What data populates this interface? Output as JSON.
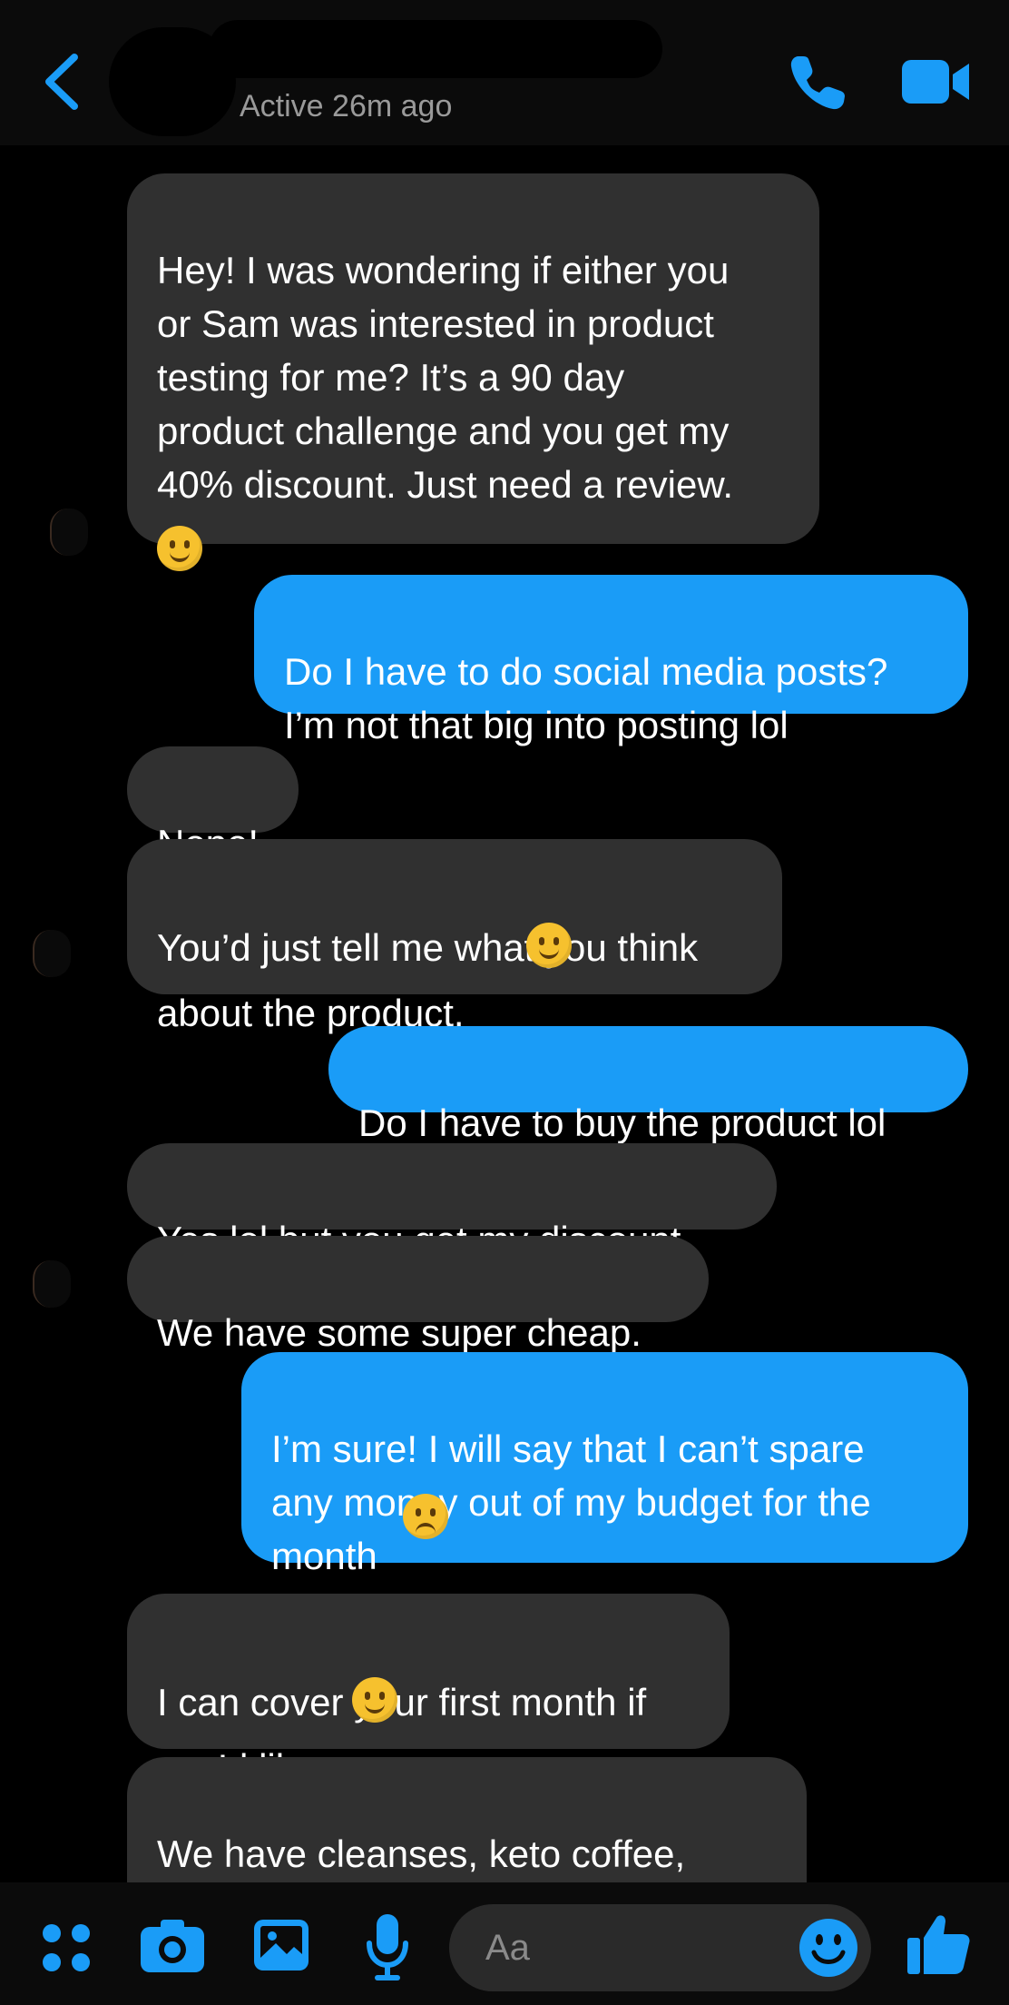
{
  "header": {
    "status": "Active 26m ago"
  },
  "messages": [
    {
      "side": "in",
      "text": "Hey! I was wondering if either you\nor Sam was interested in product\ntesting for me? It’s a 90 day\nproduct challenge and you get my\n40% discount. Just need a review.",
      "emoji": "slightly-smiling"
    },
    {
      "side": "out",
      "text": "Do I have to do social media posts?\nI’m not that big into posting lol"
    },
    {
      "side": "in",
      "text": "Nope!"
    },
    {
      "side": "in",
      "text": "You’d just tell me what you think\nabout the product.",
      "emoji": "slightly-smiling"
    },
    {
      "side": "out",
      "text": "Do I have to buy the product lol"
    },
    {
      "side": "in",
      "text": "Yes lol but you get my discount."
    },
    {
      "side": "in",
      "text": "We have some super cheap."
    },
    {
      "side": "out",
      "text": "I’m sure! I will say that I can’t spare\nany money out of my budget for the\nmonth",
      "emoji": "disappointed"
    },
    {
      "side": "in",
      "text": "I can cover your first month if\nyou’d like.",
      "emoji": "slightly-smiling"
    },
    {
      "side": "in",
      "text": "We have cleanses, keto coffee,\nhydrate, creams, etc. oh and"
    }
  ],
  "composer": {
    "placeholder": "Aa",
    "icons": [
      "menu-icon",
      "camera-icon",
      "gallery-icon",
      "microphone-icon",
      "emoji-icon",
      "thumbs-up-icon"
    ]
  },
  "colors": {
    "accent": "#1a9cf7",
    "incoming_bubble": "#303030",
    "background": "#000000"
  }
}
